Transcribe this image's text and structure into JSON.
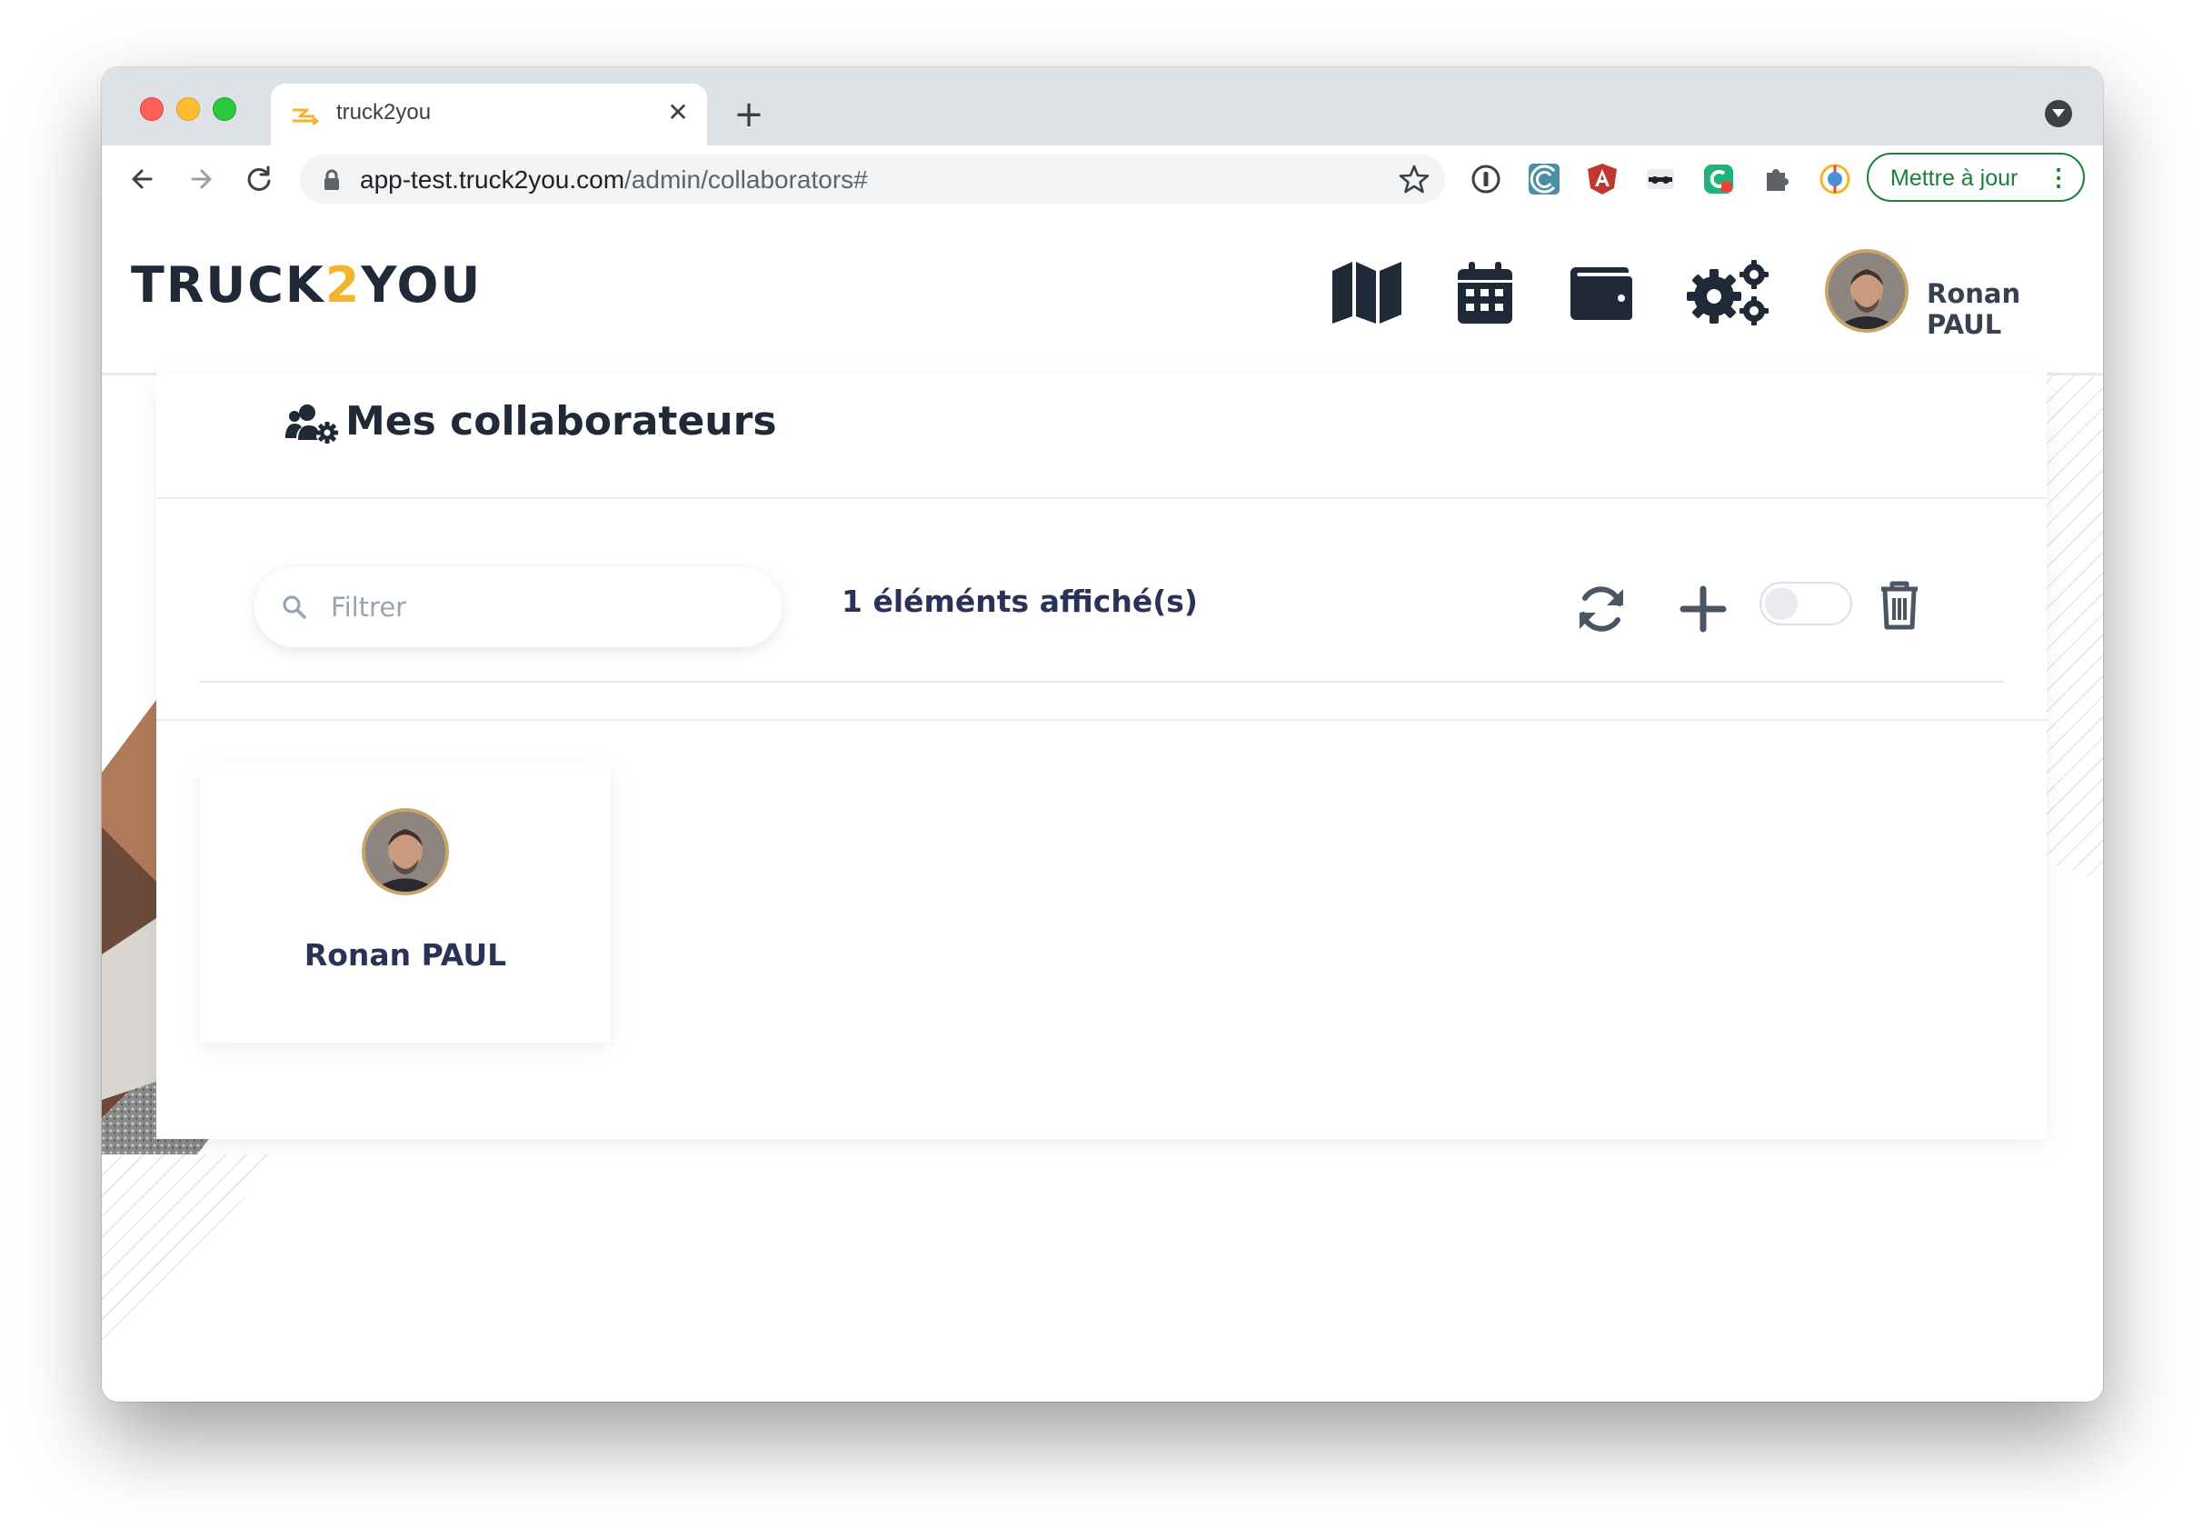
{
  "browser": {
    "tab_title": "truck2you",
    "tab_close": "✕",
    "new_tab": "+",
    "url_host": "app-test.truck2you.com",
    "url_path": "/admin/collaborators#",
    "update_button": "Mettre à jour",
    "menu_glyph": "⋮"
  },
  "header": {
    "logo_left": "TRUCK",
    "logo_mid": "2",
    "logo_right": "YOU",
    "user_name": "Ronan PAUL",
    "nav_icons": [
      "map-icon",
      "calendar-icon",
      "wallet-icon",
      "cogs-icon"
    ]
  },
  "main": {
    "title": "Mes collaborateurs",
    "filter_placeholder": "Filtrer",
    "filter_value": "",
    "count_text": "1 éléménts affiché(s)",
    "toggle_on": false,
    "tools": [
      "refresh-icon",
      "plus-icon",
      "toggle-switch",
      "trash-icon"
    ]
  },
  "collaborators": [
    {
      "name": "Ronan PAUL"
    }
  ],
  "colors": {
    "accent": "#f4b42c",
    "dark": "#1f2937",
    "navy": "#2b3257",
    "update_green": "#188038"
  }
}
